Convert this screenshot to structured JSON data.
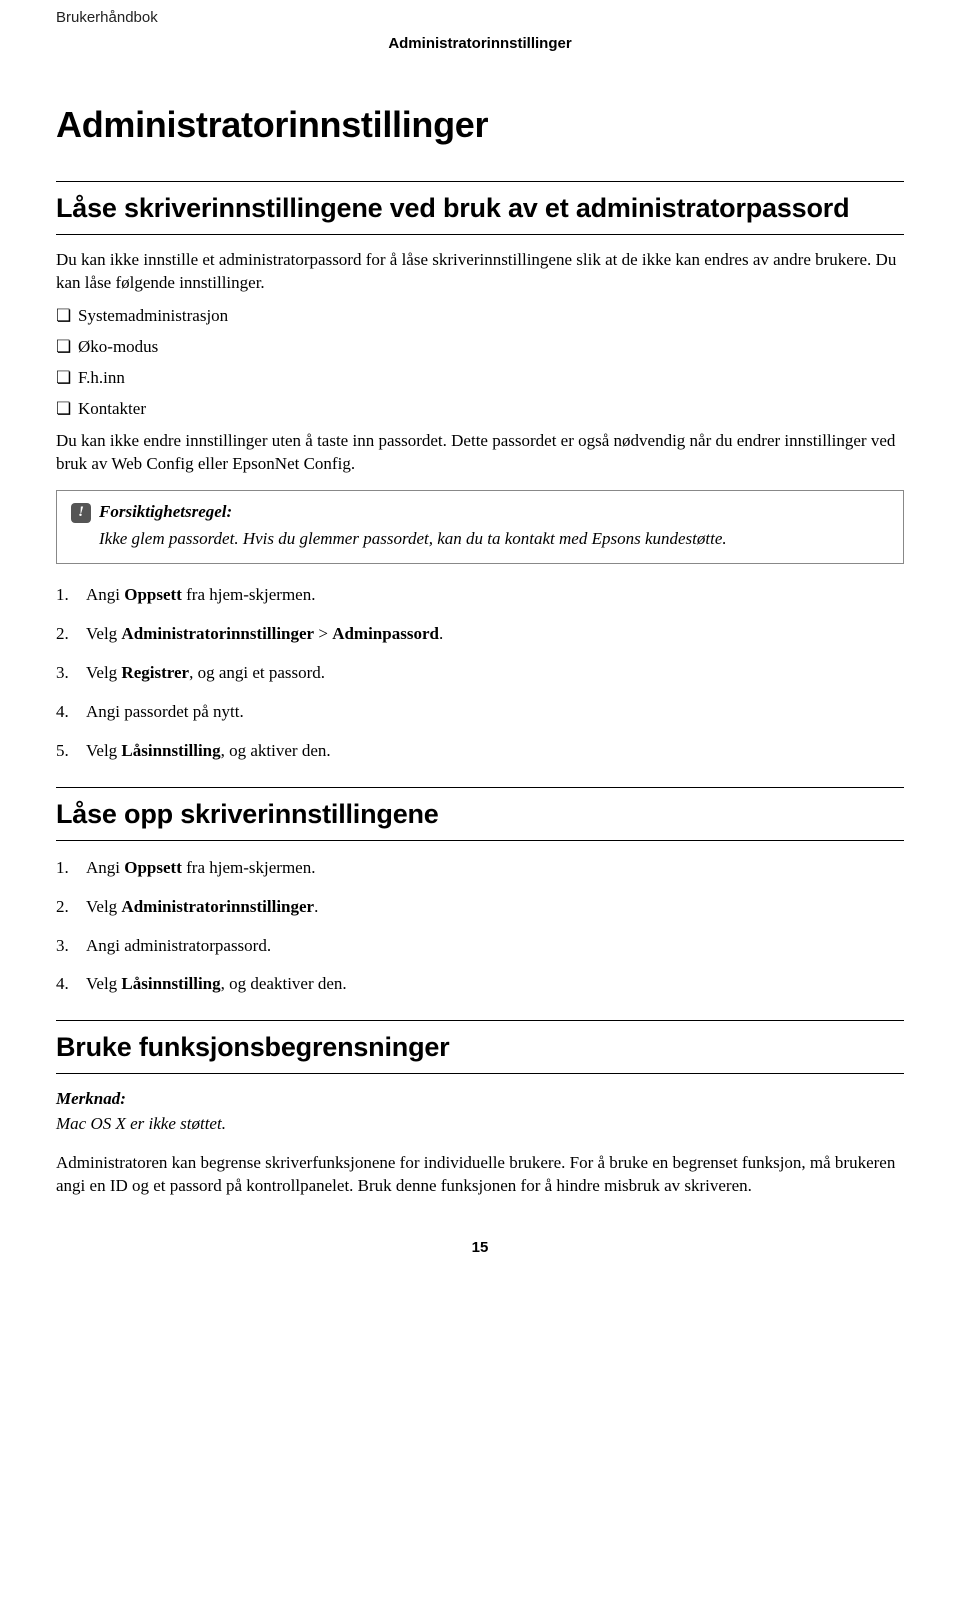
{
  "header": {
    "running_head": "Brukerhåndbok",
    "running_subhead": "Administratorinnstillinger"
  },
  "chapter_title": "Administratorinnstillinger",
  "section1": {
    "title": "Låse skriverinnstillingene ved bruk av et administratorpassord",
    "intro": "Du kan ikke innstille et administratorpassord for å låse skriverinnstillingene slik at de ikke kan endres av andre brukere. Du kan låse følgende innstillinger.",
    "bullets": [
      "Systemadministrasjon",
      "Øko-modus",
      "F.h.inn",
      "Kontakter"
    ],
    "after_bullets": "Du kan ikke endre innstillinger uten å taste inn passordet. Dette passordet er også nødvendig når du endrer innstillinger ved bruk av Web Config eller EpsonNet Config.",
    "note_title": "Forsiktighetsregel:",
    "note_body": "Ikke glem passordet. Hvis du glemmer passordet, kan du ta kontakt med Epsons kundestøtte.",
    "steps": [
      {
        "n": "1.",
        "pre": "Angi ",
        "b1": "Oppsett",
        "post": " fra hjem-skjermen."
      },
      {
        "n": "2.",
        "pre": "Velg ",
        "b1": "Administratorinnstillinger",
        "mid": " > ",
        "b2": "Adminpassord",
        "post": "."
      },
      {
        "n": "3.",
        "pre": "Velg ",
        "b1": "Registrer",
        "post": ", og angi et passord."
      },
      {
        "n": "4.",
        "pre": "Angi passordet på nytt.",
        "b1": "",
        "post": ""
      },
      {
        "n": "5.",
        "pre": "Velg ",
        "b1": "Låsinnstilling",
        "post": ", og aktiver den."
      }
    ]
  },
  "section2": {
    "title": "Låse opp skriverinnstillingene",
    "steps": [
      {
        "n": "1.",
        "pre": "Angi ",
        "b1": "Oppsett",
        "post": " fra hjem-skjermen."
      },
      {
        "n": "2.",
        "pre": "Velg ",
        "b1": "Administratorinnstillinger",
        "post": "."
      },
      {
        "n": "3.",
        "pre": "Angi administratorpassord.",
        "b1": "",
        "post": ""
      },
      {
        "n": "4.",
        "pre": "Velg ",
        "b1": "Låsinnstilling",
        "post": ", og deaktiver den."
      }
    ]
  },
  "section3": {
    "title": "Bruke funksjonsbegrensninger",
    "merk_head": "Merknad:",
    "merk_body": "Mac OS X er ikke støttet.",
    "body": "Administratoren kan begrense skriverfunksjonene for individuelle brukere. For å bruke en begrenset funksjon, må brukeren angi en ID og et passord på kontrollpanelet. Bruk denne funksjonen for å hindre misbruk av skriveren."
  },
  "page_number": "15"
}
